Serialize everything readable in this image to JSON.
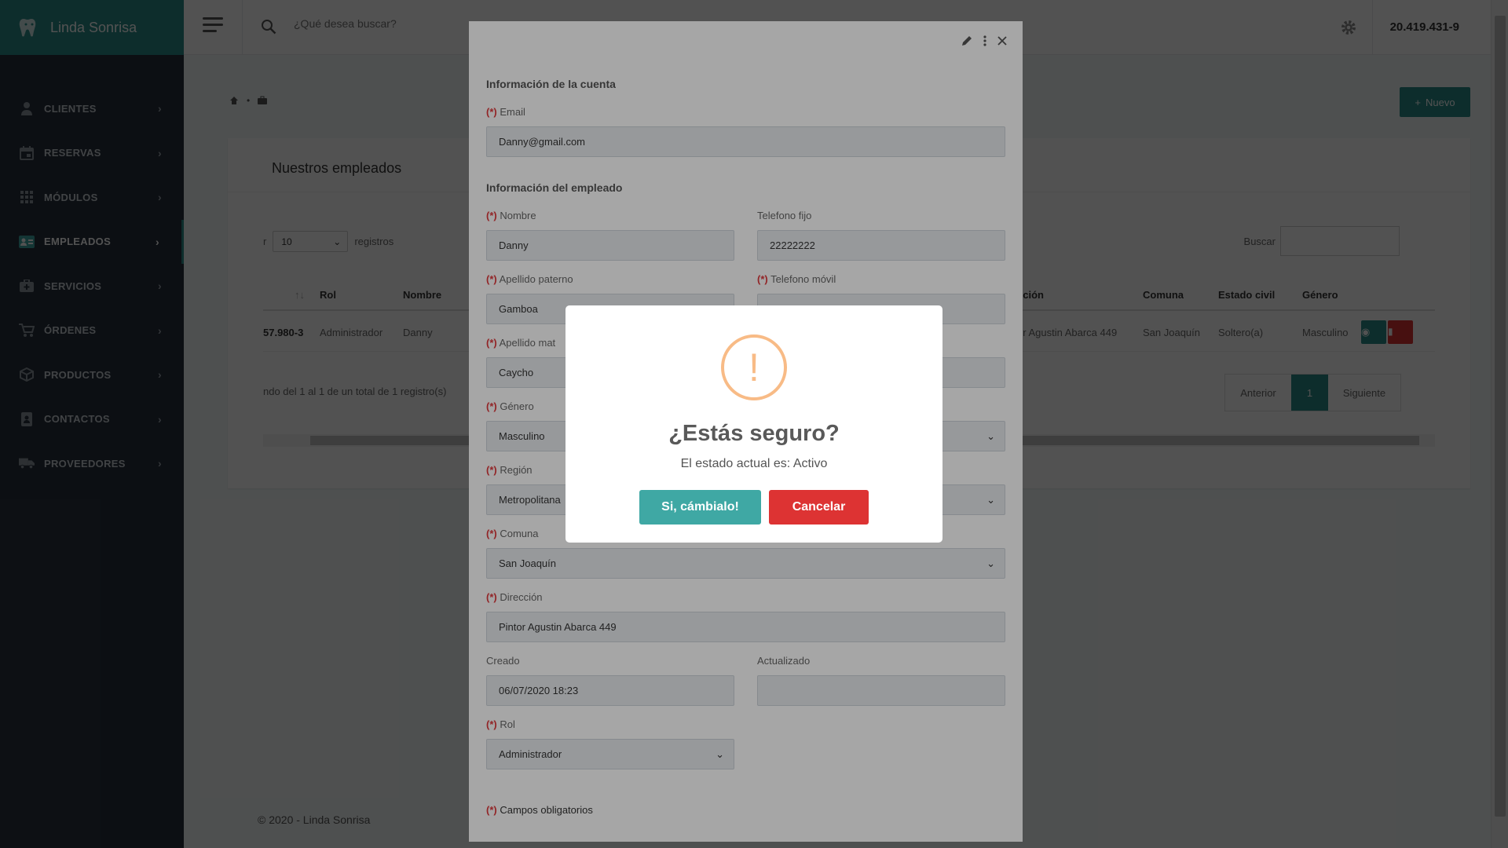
{
  "app": {
    "brand": "Linda Sonrisa",
    "user_id": "20.419.431-9"
  },
  "topbar": {
    "search_placeholder": "¿Qué desea buscar?"
  },
  "sidebar": {
    "items": [
      {
        "label": "CLIENTES",
        "icon": "user-tie-icon"
      },
      {
        "label": "RESERVAS",
        "icon": "calendar-icon"
      },
      {
        "label": "MÓDULOS",
        "icon": "grid-icon"
      },
      {
        "label": "EMPLEADOS",
        "icon": "id-card-icon"
      },
      {
        "label": "SERVICIOS",
        "icon": "briefcase-medical-icon"
      },
      {
        "label": "ÓRDENES",
        "icon": "cart-icon"
      },
      {
        "label": "PRODUCTOS",
        "icon": "box-icon"
      },
      {
        "label": "CONTACTOS",
        "icon": "address-book-icon"
      },
      {
        "label": "PROVEEDORES",
        "icon": "truck-icon"
      }
    ],
    "active": "EMPLEADOS"
  },
  "page": {
    "new_button": "Nuevo",
    "card_title": "Nuestros empleados",
    "length_prefix": "r",
    "length_value": "10",
    "length_suffix": "registros",
    "search_label": "Buscar",
    "columns": [
      "Rol",
      "Nombre",
      "cción",
      "Comuna",
      "Estado civil",
      "Género"
    ],
    "row": {
      "rut": "57.980-3",
      "rol": "Administrador",
      "nombre": "Danny",
      "direccion": "or Agustin Abarca 449",
      "comuna": "San Joaquín",
      "estado_civil": "Soltero(a)",
      "genero": "Masculino"
    },
    "info": "ndo del 1 al 1 de un total de 1 registro(s)",
    "pager": {
      "prev": "Anterior",
      "current": "1",
      "next": "Siguiente"
    },
    "footer": "© 2020 - Linda Sonrisa"
  },
  "form": {
    "section_account": "Información de la cuenta",
    "section_employee": "Información del empleado",
    "req_mark": "(*)",
    "email": {
      "label": "Email",
      "value": "Danny@gmail.com"
    },
    "nombre": {
      "label": "Nombre",
      "value": "Danny"
    },
    "telefono_fijo": {
      "label": "Telefono fijo",
      "value": "22222222"
    },
    "apellido_paterno": {
      "label": "Apellido paterno",
      "value": "Gamboa"
    },
    "telefono_movil": {
      "label": "Telefono móvil",
      "value": ""
    },
    "apellido_materno": {
      "label": "Apellido mat",
      "value": "Caycho"
    },
    "genero": {
      "label": "Género",
      "value": "Masculino"
    },
    "region": {
      "label": "Región",
      "value": "Metropolitana"
    },
    "comuna": {
      "label": "Comuna",
      "value": "San Joaquín"
    },
    "direccion": {
      "label": "Dirección",
      "value": "Pintor Agustin Abarca 449"
    },
    "creado": {
      "label": "Creado",
      "value": "06/07/2020 18:23"
    },
    "actualizado": {
      "label": "Actualizado",
      "value": ""
    },
    "rol": {
      "label": "Rol",
      "value": "Administrador"
    },
    "required_note": "Campos obligatorios"
  },
  "confirm": {
    "icon": "!",
    "title": "¿Estás seguro?",
    "text": "El estado actual es: Activo",
    "confirm_label": "Si, cámbialo!",
    "cancel_label": "Cancelar"
  },
  "colors": {
    "brand": "#2b8c88",
    "sidebar": "#27313d",
    "confirm_btn": "#3fa8a4",
    "cancel_btn": "#dd3333",
    "warning": "#f8bb86",
    "required": "#e0383b"
  }
}
